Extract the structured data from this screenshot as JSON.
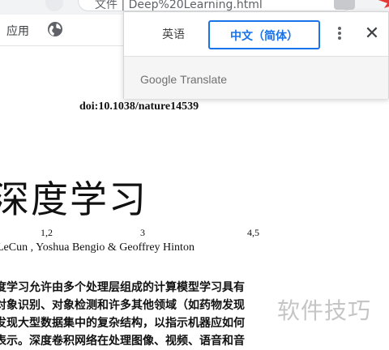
{
  "browser": {
    "address_text": "文件 | Deep%20Learning.html",
    "bookmarks": {
      "apps_label": "应用"
    }
  },
  "translate_popup": {
    "source_lang": "英语",
    "target_lang": "中文（简体）",
    "brand": {
      "google": "Google",
      "translate": "Translate"
    },
    "colors": {
      "accent": "#1a73e8"
    }
  },
  "document": {
    "doi": "doi:10.1038/nature14539",
    "title": "深度学习",
    "author_superscripts": [
      "1,2",
      "3",
      "4,5"
    ],
    "authors": "LeCun , Yoshua Bengio  & Geoffrey Hinton",
    "abstract_lines": [
      "度学习允许由多个处理层组成的计算模型学习具有",
      "对象识别、对象检测和许多其他领域（如药物发现",
      "发现大型数据集中的复杂结构，以指示机器应如何",
      "表示。深度卷积网络在处理图像、视频、语音和音"
    ]
  },
  "watermark": "软件技巧"
}
